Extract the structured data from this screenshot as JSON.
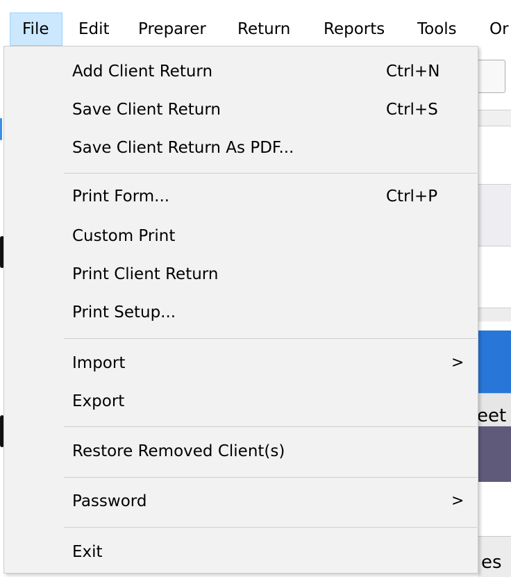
{
  "menubar": {
    "items": [
      "File",
      "Edit",
      "Preparer",
      "Return",
      "Reports",
      "Tools",
      "Or"
    ]
  },
  "file_menu": {
    "add_client_return": {
      "label": "Add Client Return",
      "shortcut": "Ctrl+N"
    },
    "save_client_return": {
      "label": "Save Client Return",
      "shortcut": "Ctrl+S"
    },
    "save_as_pdf": {
      "label": "Save Client Return As PDF..."
    },
    "print_form": {
      "label": "Print Form...",
      "shortcut": "Ctrl+P"
    },
    "custom_print": {
      "label": "Custom Print"
    },
    "print_client_return": {
      "label": "Print Client Return"
    },
    "print_setup": {
      "label": "Print Setup..."
    },
    "import": {
      "label": "Import",
      "arrow": ">"
    },
    "export": {
      "label": "Export"
    },
    "restore_removed_clients": {
      "label": "Restore Removed Client(s)"
    },
    "password": {
      "label": "Password",
      "arrow": ">"
    },
    "exit": {
      "label": "Exit"
    }
  },
  "background": {
    "partial_tab_1": "eet",
    "partial_tab_2": "es"
  },
  "colors": {
    "menu_background": "#f2f2f2",
    "active_menubar": "#cce8ff",
    "accent_blue": "#2876d8",
    "purple_band": "#5f5a7a"
  }
}
